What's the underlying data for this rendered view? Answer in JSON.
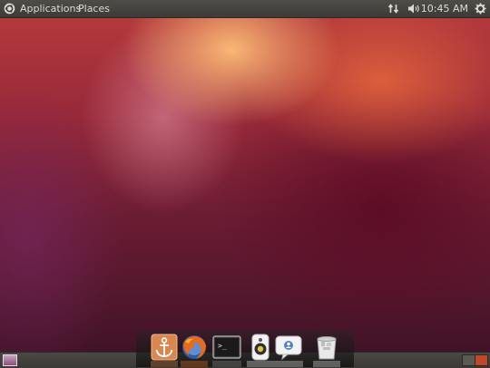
{
  "top_panel": {
    "menu": [
      "Applications",
      "Places"
    ],
    "clock": "10:45 AM",
    "tray_icons": [
      "network-icon",
      "volume-icon",
      "session-gear-icon"
    ]
  },
  "dock": {
    "items": [
      {
        "name": "dock-anchor-icon"
      },
      {
        "name": "firefox-icon"
      },
      {
        "name": "terminal-icon"
      },
      {
        "name": "speaker-icon"
      },
      {
        "name": "messenger-icon"
      },
      {
        "name": "trash-icon"
      }
    ]
  },
  "colors": {
    "panel": "#3c3b37",
    "accent": "#dd4814"
  }
}
